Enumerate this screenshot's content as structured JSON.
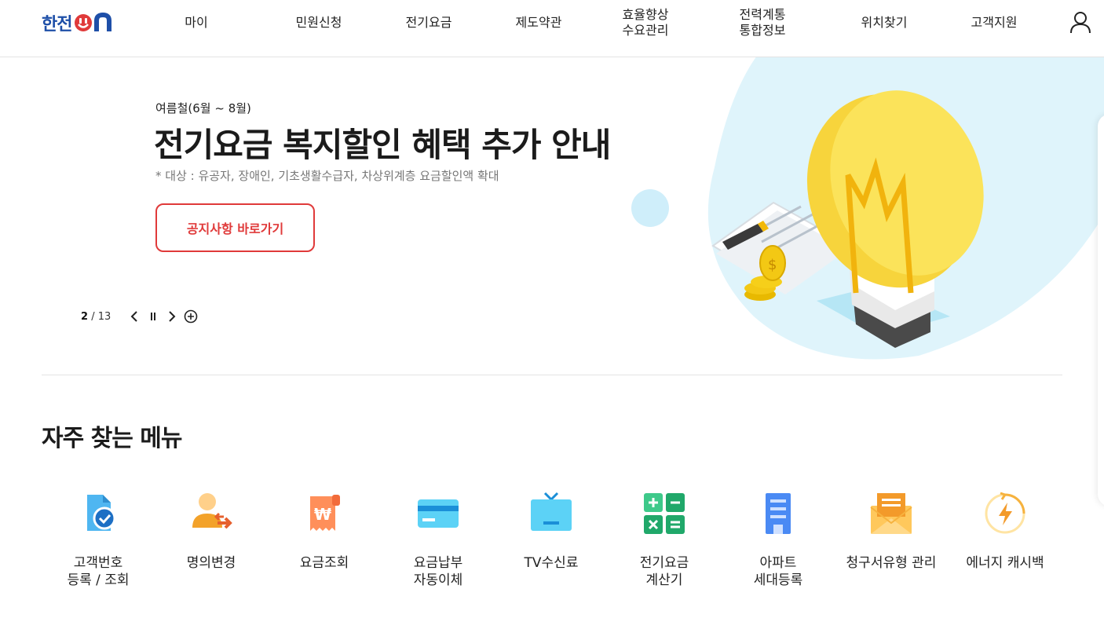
{
  "header": {
    "logo_text": "한전",
    "logo_on_text": "ON",
    "nav": [
      {
        "label": "마이"
      },
      {
        "label": "민원신청"
      },
      {
        "label": "전기요금"
      },
      {
        "label": "제도약관"
      },
      {
        "label": "효율향상\n수요관리"
      },
      {
        "label": "전력계통\n통합정보"
      },
      {
        "label": "위치찾기"
      },
      {
        "label": "고객지원"
      }
    ],
    "user_icon": "user-icon"
  },
  "hero": {
    "eyebrow": "여름철(6월 ~ 8월)",
    "title": "전기요금 복지할인 혜택 추가 안내",
    "subtitle": "* 대상 : 유공자, 장애인, 기초생활수급자, 차상위계층 요금할인액 확대",
    "button_label": "공지사항 바로가기",
    "pager": {
      "current": "2",
      "separator": "/",
      "total": "13"
    },
    "colors": {
      "accent": "#e03a3a",
      "bulb": "#f7d43c",
      "sky": "#dff4fb"
    }
  },
  "section": {
    "title": "자주 찾는 메뉴",
    "items": [
      {
        "label": "고객번호\n등록 / 조회",
        "icon": "document-check-icon"
      },
      {
        "label": "명의변경",
        "icon": "person-transfer-icon"
      },
      {
        "label": "요금조회",
        "icon": "won-receipt-icon"
      },
      {
        "label": "요금납부\n자동이체",
        "icon": "credit-card-icon"
      },
      {
        "label": "TV수신료",
        "icon": "tv-icon"
      },
      {
        "label": "전기요금\n계산기",
        "icon": "calculator-icon"
      },
      {
        "label": "아파트\n세대등록",
        "icon": "apartment-icon"
      },
      {
        "label": "청구서유형 관리",
        "icon": "envelope-icon"
      },
      {
        "label": "에너지 캐시백",
        "icon": "energy-cashback-icon"
      }
    ]
  }
}
